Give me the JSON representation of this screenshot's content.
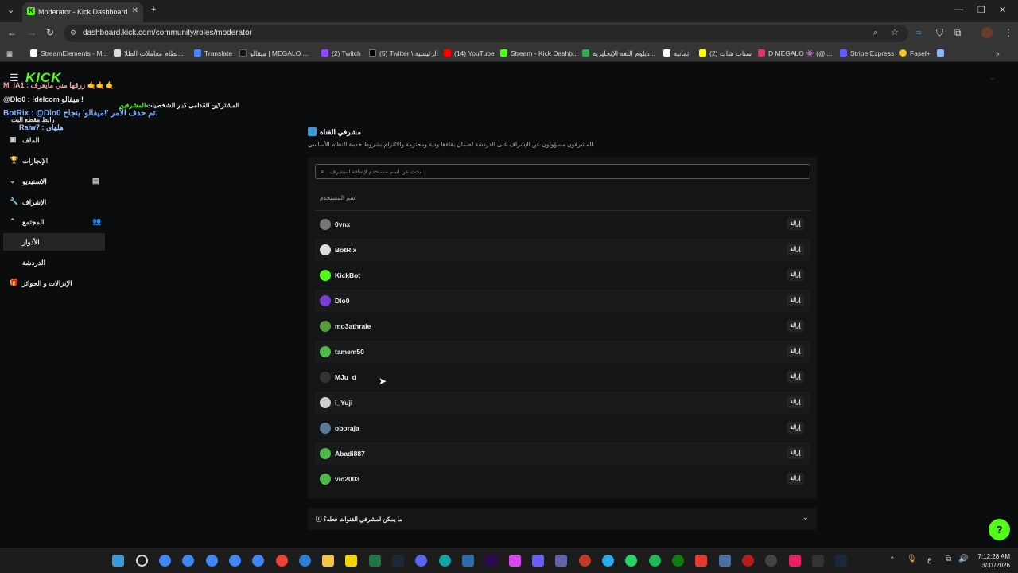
{
  "browser": {
    "tab_title": "Moderator - Kick Dashboard",
    "url": "dashboard.kick.com/community/roles/moderator",
    "bookmarks": [
      {
        "label": "StreamElements - M...",
        "color": "#ffffff"
      },
      {
        "label": "نظام معاملات الطلا...",
        "color": "#ffffff"
      },
      {
        "label": "Translate",
        "color": "#4a8af4"
      },
      {
        "label": "ميقالو | MEGALO ...",
        "color": "#000000"
      },
      {
        "label": "(2) Twitch",
        "color": "#9146ff"
      },
      {
        "label": "(5) Twitter \\ الرئيسية",
        "color": "#000000"
      },
      {
        "label": "(14) YouTube",
        "color": "#ff0000"
      },
      {
        "label": "Stream - Kick Dashb...",
        "color": "#53fc18"
      },
      {
        "label": "دبلوم اللغة الإنجليزية...",
        "color": "#34a853"
      },
      {
        "label": "ثمانية",
        "color": "#ffffff"
      },
      {
        "label": "(2) سناب شات",
        "color": "#fffc00"
      },
      {
        "label": "D MEGALO 👾 (@i...",
        "color": "#e1306c"
      },
      {
        "label": "Stripe Express",
        "color": "#635bff"
      },
      {
        "label": "Fasel+",
        "color": "#f5c518"
      }
    ]
  },
  "brand": {
    "logo": "KICK",
    "accent": "#53fc18"
  },
  "chat_overlay": {
    "line1": "M_IA1 : زرقها مني مايعرف 🤙🤙🤙",
    "line2": "@Dlo0 : !delcom ميقالو !",
    "line3": "المشرفين",
    "line3b": "المشتركين القدامى  كبار الشخصيات",
    "line4": "BotRix : @Dlo0 تم حذف الأمر '!ميقالو' بنجاح.",
    "line5": "رابط مقطع البث",
    "line6": "Raiw7 : هلهاي"
  },
  "sidebar": {
    "items": [
      {
        "label": "الملف",
        "icon": "profile-icon"
      },
      {
        "label": "الإنجازات",
        "icon": "trophy-icon"
      },
      {
        "label": "الاستيديو",
        "icon": "studio-icon"
      },
      {
        "label": "الإشراف",
        "icon": "wrench-icon"
      },
      {
        "label": "المجتمع",
        "icon": "community-icon"
      },
      {
        "label": "الأدوار",
        "icon": ""
      },
      {
        "label": "الدردشة",
        "icon": ""
      },
      {
        "label": "الإنزالات و الجوائز",
        "icon": "gift-icon"
      }
    ]
  },
  "main": {
    "title": "مشرفي القناة",
    "subtitle": "المشرفون مسؤولون عن الإشراف على الدردشة لضمان بقاءها ودية ومحترمة والالتزام بشروط خدمة النظام الأساسي.",
    "search_placeholder": "ابحث عن اسم مستخدم لإضافة المشرف",
    "column_header": "اسم المستخدم",
    "remove_label": "إزالة",
    "moderators": [
      {
        "name": "0vnx",
        "avatar_color": "#777777"
      },
      {
        "name": "BotRix",
        "avatar_color": "#dddddd"
      },
      {
        "name": "KickBot",
        "avatar_color": "#53fc18"
      },
      {
        "name": "Dlo0",
        "avatar_color": "#7a3fd0"
      },
      {
        "name": "mo3athraie",
        "avatar_color": "#5b9b3f"
      },
      {
        "name": "tamem50",
        "avatar_color": "#4fb84a"
      },
      {
        "name": "MJu_d",
        "avatar_color": "#333333"
      },
      {
        "name": "i_Yuji",
        "avatar_color": "#cfcfcf"
      },
      {
        "name": "oboraja",
        "avatar_color": "#5a7a9a"
      },
      {
        "name": "Abadi887",
        "avatar_color": "#4fb84a"
      },
      {
        "name": "vio2003",
        "avatar_color": "#4fb84a"
      }
    ],
    "faq_question": "ما يمكن لمشرفي القنوات فعله؟"
  },
  "taskbar": {
    "time": "7:12:28 AM",
    "date": "3/31/2026",
    "lang": "ع"
  }
}
